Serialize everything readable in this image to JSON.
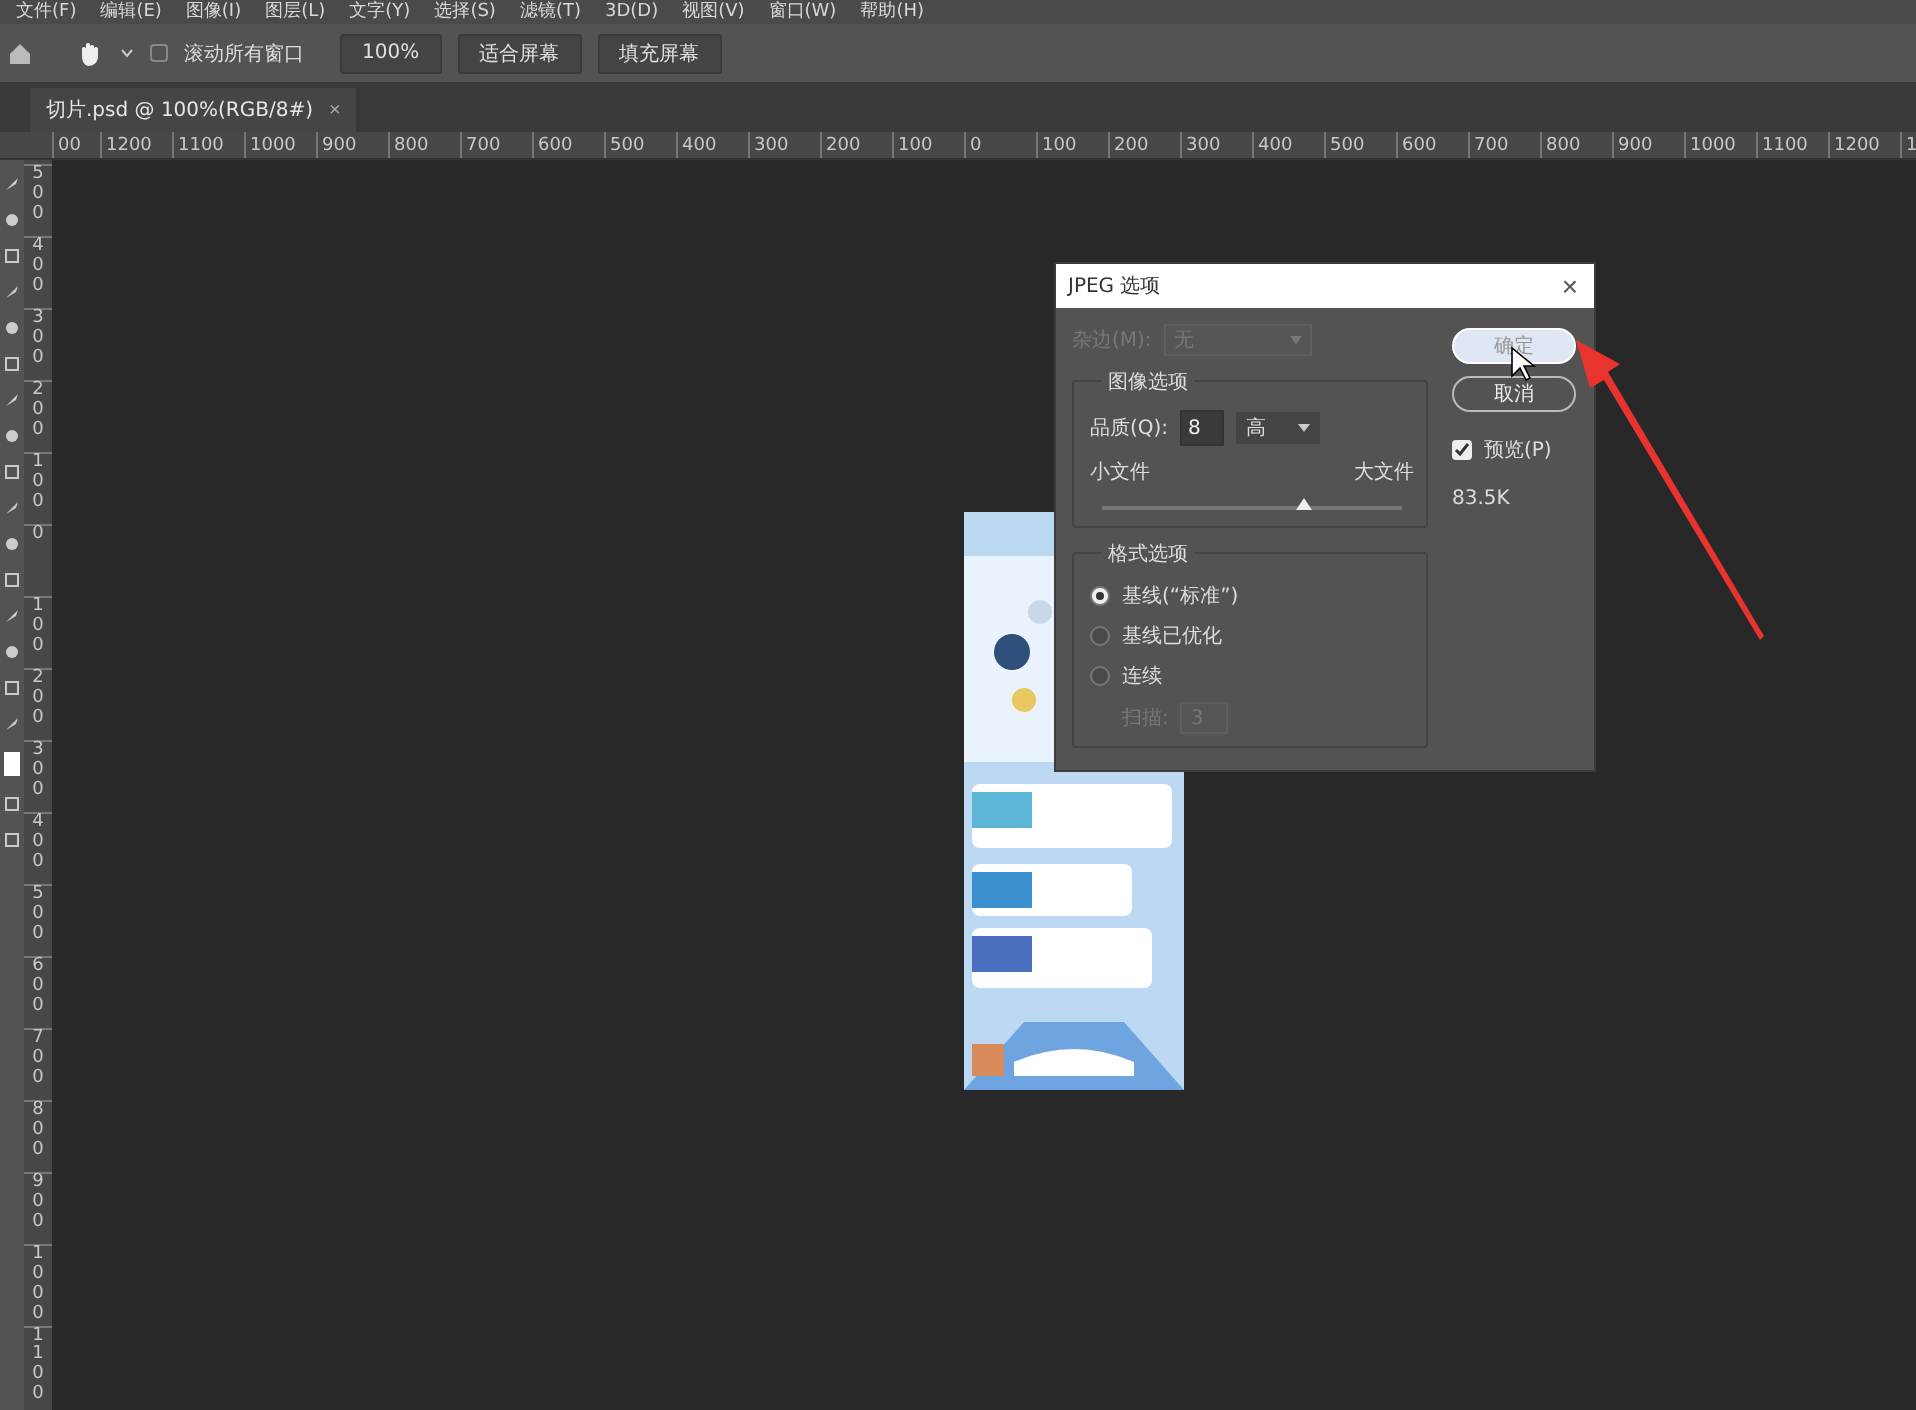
{
  "menu_bar": [
    "文件(F)",
    "编辑(E)",
    "图像(I)",
    "图层(L)",
    "文字(Y)",
    "选择(S)",
    "滤镜(T)",
    "3D(D)",
    "视图(V)",
    "窗口(W)",
    "帮助(H)"
  ],
  "options_bar": {
    "scroll_all": {
      "label": "滚动所有窗口",
      "checked": false
    },
    "buttons": [
      "100%",
      "适合屏幕",
      "填充屏幕"
    ]
  },
  "document_tab": {
    "title": "切片.psd @ 100%(RGB/8#)",
    "close": "×"
  },
  "ruler_h": [
    "00",
    "1200",
    "1100",
    "1000",
    "900",
    "800",
    "700",
    "600",
    "500",
    "400",
    "300",
    "200",
    "100",
    "0",
    "100",
    "200",
    "300",
    "400",
    "500",
    "600",
    "700",
    "800",
    "900",
    "1000",
    "1100",
    "1200",
    "1"
  ],
  "ruler_v": [
    "500",
    "400",
    "300",
    "200",
    "100",
    "0",
    "100",
    "200",
    "300",
    "400",
    "500",
    "600",
    "700",
    "800",
    "900",
    "1000",
    "1100"
  ],
  "dialog": {
    "title": "JPEG 选项",
    "close": "×",
    "matte": {
      "label": "杂边(M):",
      "value": "无",
      "disabled": true
    },
    "image_options": {
      "title": "图像选项",
      "quality_label": "品质(Q):",
      "quality": "8",
      "preset": "高",
      "min_label": "小文件",
      "max_label": "大文件",
      "level": 0.67
    },
    "format_options": {
      "title": "格式选项",
      "options": [
        {
          "label": "基线(“标准”)",
          "selected": true
        },
        {
          "label": "基线已优化",
          "selected": false
        },
        {
          "label": "连续",
          "selected": false
        }
      ],
      "scans_label": "扫描:",
      "scans": "3",
      "scans_disabled": true
    },
    "buttons": [
      {
        "label": "确定",
        "default": true
      },
      {
        "label": "取消",
        "default": false
      }
    ],
    "preview": {
      "label": "预览(P)",
      "checked": true
    },
    "size": "83.5K"
  }
}
